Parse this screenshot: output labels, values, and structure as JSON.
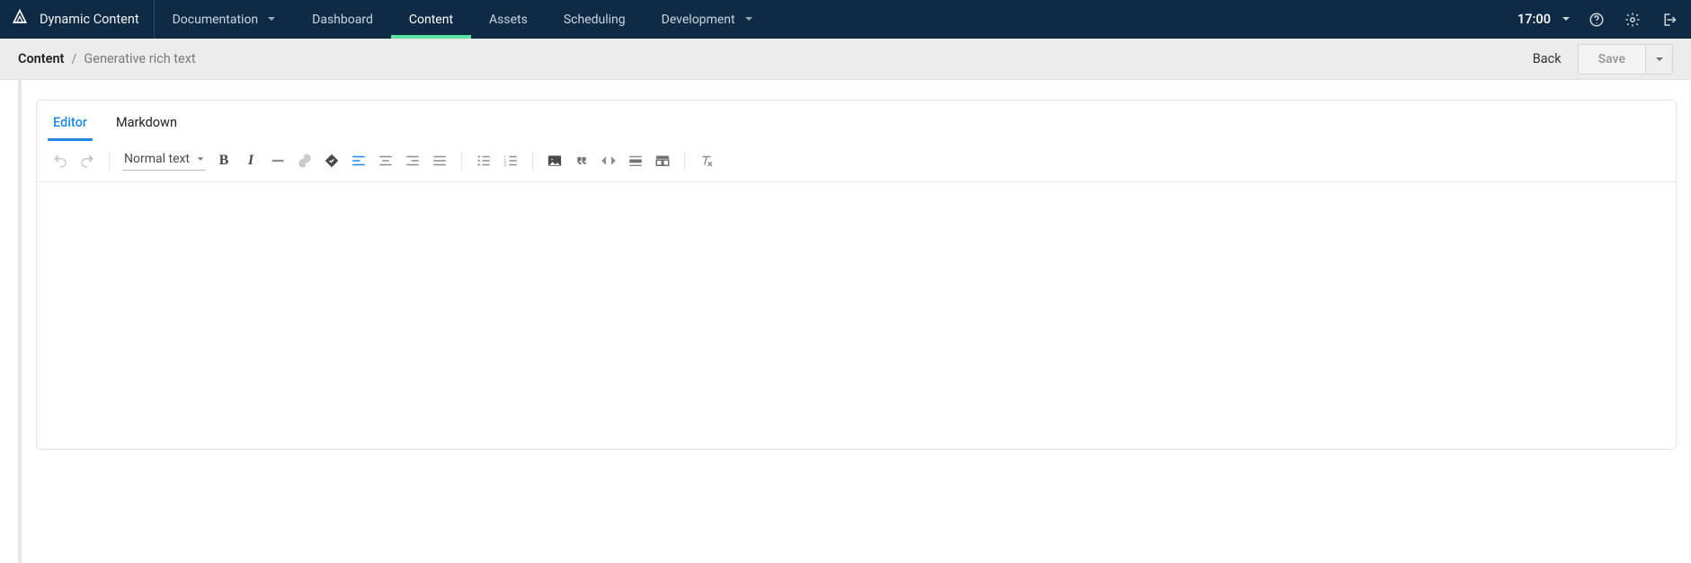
{
  "brand": {
    "name": "Dynamic Content"
  },
  "nav": {
    "documentation": "Documentation",
    "dashboard": "Dashboard",
    "content": "Content",
    "assets": "Assets",
    "scheduling": "Scheduling",
    "development": "Development"
  },
  "header": {
    "time": "17:00"
  },
  "breadcrumb": {
    "root": "Content",
    "separator": "/",
    "current": "Generative rich text"
  },
  "actions": {
    "back": "Back",
    "save": "Save"
  },
  "tabs": {
    "editor": "Editor",
    "markdown": "Markdown"
  },
  "toolbar": {
    "format_label": "Normal text"
  }
}
